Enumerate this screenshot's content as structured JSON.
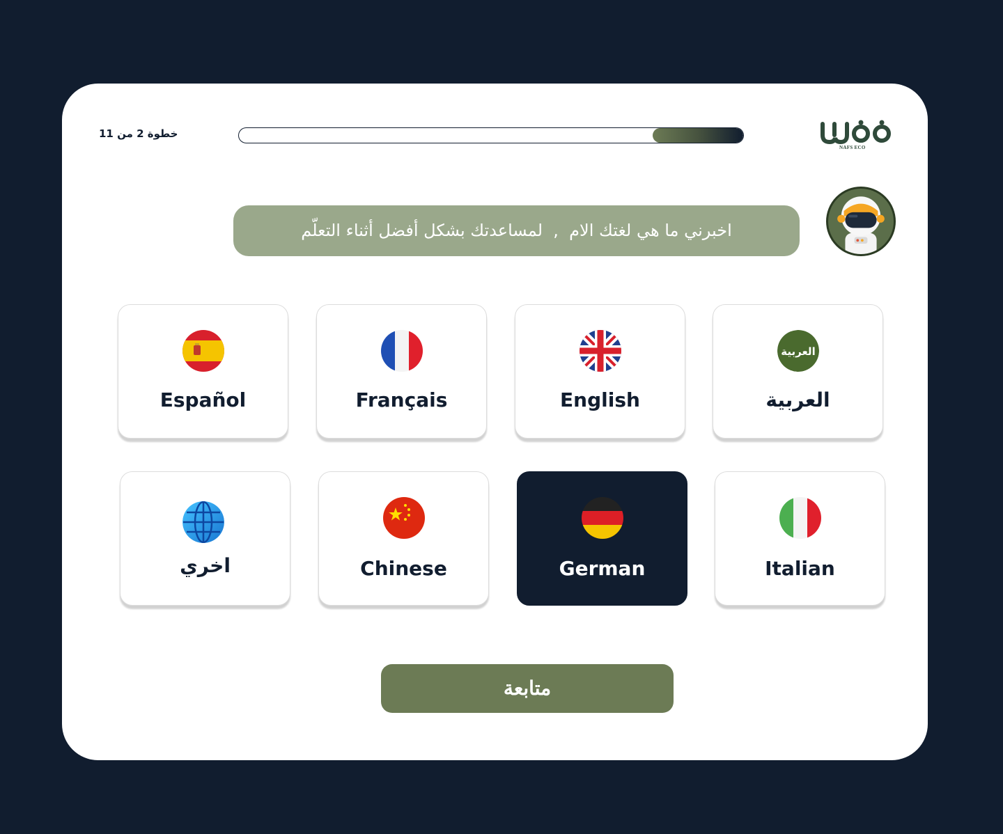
{
  "header": {
    "step_text": "خطوة 2 من 11",
    "progress_fraction": 0.18,
    "logo_subtext": "NAFS ECO",
    "logo_icon": "nafs-logo-icon"
  },
  "assistant": {
    "avatar_icon": "astronaut-avatar-icon",
    "message": "اخبرني ما هي لغتك الام  ,  لمساعدتك بشكل أفضل أثناء التعلّم"
  },
  "languages": [
    {
      "label": "العربية",
      "flag": "arabic-flag-icon",
      "selected": false
    },
    {
      "label": "English",
      "flag": "uk-flag-icon",
      "selected": false
    },
    {
      "label": "Français",
      "flag": "france-flag-icon",
      "selected": false
    },
    {
      "label": "Español",
      "flag": "spain-flag-icon",
      "selected": false
    },
    {
      "label": "Italian",
      "flag": "italy-flag-icon",
      "selected": false
    },
    {
      "label": "German",
      "flag": "germany-flag-icon",
      "selected": true
    },
    {
      "label": "Chinese",
      "flag": "china-flag-icon",
      "selected": false
    },
    {
      "label": "اخري",
      "flag": "globe-icon",
      "selected": false
    }
  ],
  "arabic_flag_text": "العربية",
  "continue_label": "متابعة",
  "colors": {
    "background": "#111d2f",
    "accent_green": "#6c7b55",
    "bubble_green": "#9aa88b",
    "selected_card": "#111d2f"
  }
}
